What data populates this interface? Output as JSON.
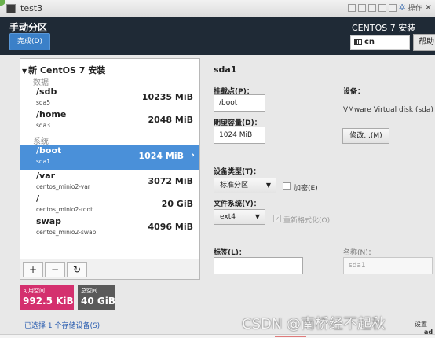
{
  "window": {
    "title": "test3",
    "ops_label": "操作"
  },
  "header": {
    "page_title": "手动分区",
    "done_label": "完成(D)",
    "product": "CENTOS 7 安装",
    "keyboard": "cn",
    "help_label": "帮助"
  },
  "tree": {
    "root_label": "新 CentOS 7 安装",
    "data_section": "数据",
    "system_section": "系统",
    "data_items": [
      {
        "name": "/sdb",
        "device": "sda5",
        "size": "10235 MiB"
      },
      {
        "name": "/home",
        "device": "sda3",
        "size": "2048 MiB"
      }
    ],
    "system_items": [
      {
        "name": "/boot",
        "device": "sda1",
        "size": "1024 MiB"
      },
      {
        "name": "/var",
        "device": "centos_minio2-var",
        "size": "3072 MiB"
      },
      {
        "name": "/",
        "device": "centos_minio2-root",
        "size": "20 GiB"
      },
      {
        "name": "swap",
        "device": "centos_minio2-swap",
        "size": "4096 MiB"
      }
    ],
    "toolbar": {
      "add": "+",
      "remove": "−",
      "refresh": "↻"
    }
  },
  "space": {
    "available_label": "可用空间",
    "available_value": "992.5 KiB",
    "total_label": "总空间",
    "total_value": "40 GiB"
  },
  "storage_link": "已选择 1 个存储设备(S)",
  "detail": {
    "title": "sda1",
    "mount_label": "挂载点(P)：",
    "mount_value": "/boot",
    "capacity_label": "期望容量(D)：",
    "capacity_value": "1024 MiB",
    "device_label": "设备：",
    "device_value": "VMware Virtual disk (sda)",
    "modify_label": "修改...(M)",
    "devtype_label": "设备类型(T)：",
    "devtype_value": "标准分区",
    "encrypt_label": "加密(E)",
    "fs_label": "文件系统(Y)：",
    "fs_value": "ext4",
    "reformat_label": "重新格式化(O)",
    "tag_label": "标签(L)：",
    "tag_value": "",
    "name_label": "名称(N)：",
    "name_value": "sda1"
  },
  "watermark": "CSDN @南桥经不起秋",
  "corner_text": "设置",
  "corner_text2": "ad",
  "colors": {
    "header_bg": "#1f2a36",
    "done_button": "#3b80c8",
    "selected_row": "#4a90d9",
    "available_box": "#d4306e",
    "total_box": "#5a5a5a"
  }
}
